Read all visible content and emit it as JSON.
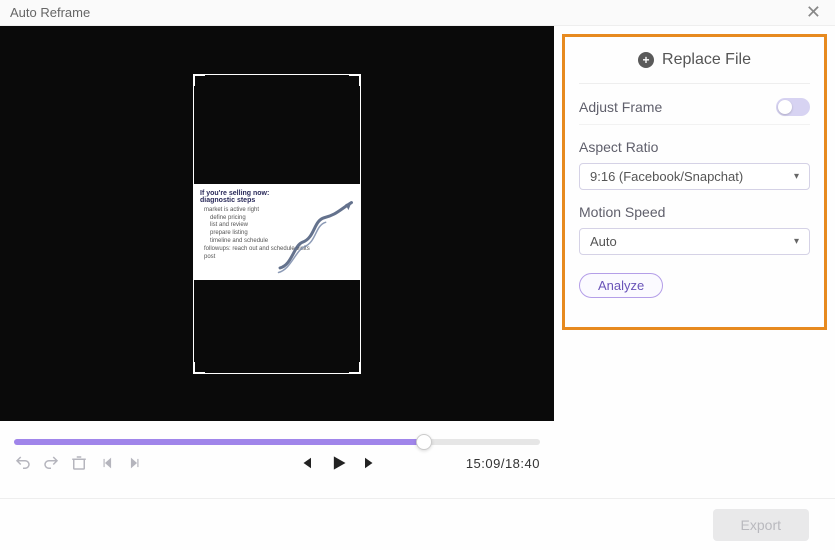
{
  "titlebar": {
    "title": "Auto Reframe"
  },
  "slide": {
    "title1": "If you're selling now:",
    "title2": "diagnostic steps",
    "lines": [
      "market is active right",
      "define pricing",
      "list and review",
      "prepare listing",
      "timeline and schedule",
      "followups: reach out and schedule visits",
      "post"
    ]
  },
  "timeline": {
    "current": "15:09",
    "total": "18:40",
    "combined": "15:09/18:40",
    "progress_pct": "78%"
  },
  "sidebar": {
    "replace_label": "Replace File",
    "adjust_frame_label": "Adjust Frame",
    "aspect_ratio_label": "Aspect Ratio",
    "aspect_ratio_value": "9:16 (Facebook/Snapchat)",
    "motion_speed_label": "Motion Speed",
    "motion_speed_value": "Auto",
    "analyze_label": "Analyze"
  },
  "footer": {
    "export_label": "Export"
  },
  "colors": {
    "accent": "#a085ea",
    "highlight_border": "#e78a1f"
  }
}
